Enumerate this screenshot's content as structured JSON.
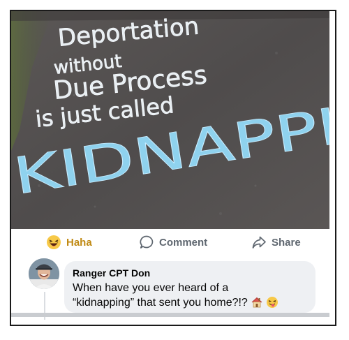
{
  "photo": {
    "chalk_lines": [
      "Deportation",
      "without",
      "Due Process",
      "is just called",
      "KIDNAPPI"
    ]
  },
  "actions": {
    "haha_label": "Haha",
    "comment_label": "Comment",
    "share_label": "Share"
  },
  "comment": {
    "author": "Ranger CPT Don",
    "text_line1": "When have you ever heard of a",
    "text_line2": "“kidnapping” that sent you home?!?"
  },
  "colors": {
    "haha_accent": "#c08a14",
    "bubble_bg": "#eef0f3",
    "chalk_blue": "#8fd2ee"
  }
}
